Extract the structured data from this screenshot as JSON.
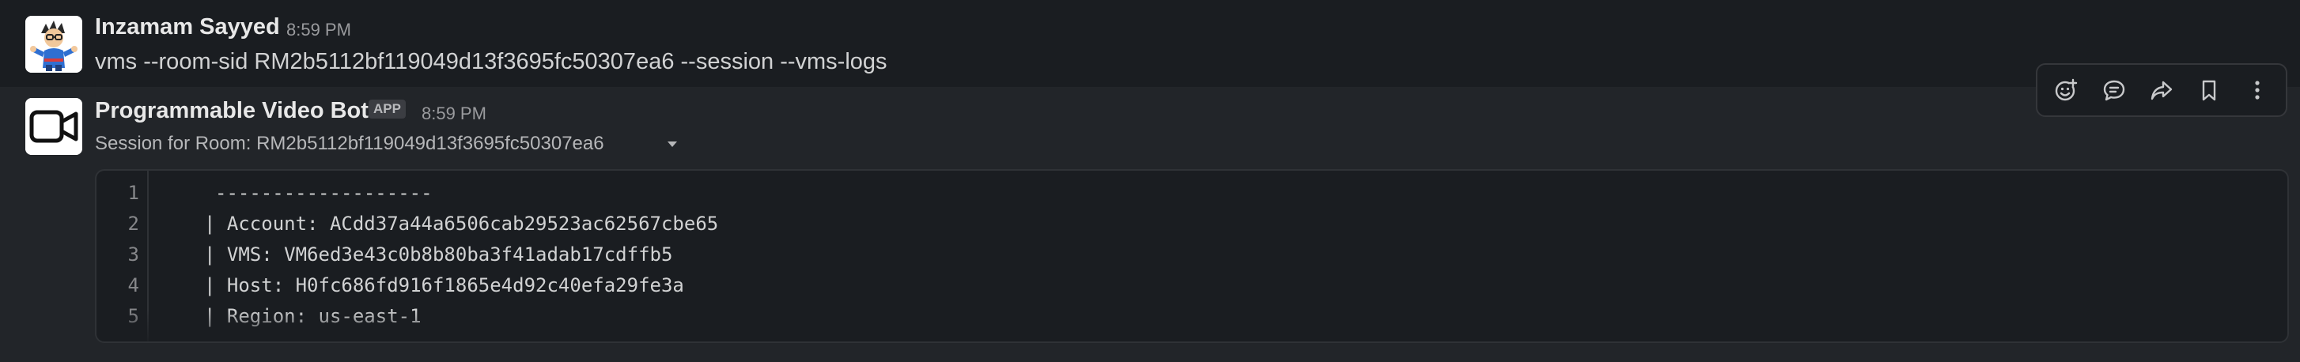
{
  "messages": [
    {
      "author": "Inzamam Sayyed",
      "time": "8:59 PM",
      "text": "vms --room-sid RM2b5112bf119049d13f3695fc50307ea6 --session --vms-logs"
    },
    {
      "author": "Programmable Video Bot",
      "badge": "APP",
      "time": "8:59 PM",
      "subtitle": "Session for Room: RM2b5112bf119049d13f3695fc50307ea6",
      "code_lines": [
        {
          "num": "1",
          "text": "-------------------"
        },
        {
          "num": "2",
          "text": "| Account: ACdd37a44a6506cab29523ac62567cbe65"
        },
        {
          "num": "3",
          "text": "| VMS: VM6ed3e43c0b8b80ba3f41adab17cdffb5"
        },
        {
          "num": "4",
          "text": "| Host: H0fc686fd916f1865e4d92c40efa29fe3a"
        },
        {
          "num": "5",
          "text": "| Region: us-east-1"
        }
      ]
    }
  ],
  "toolbar": {
    "icons": [
      "add-reaction-icon",
      "reply-in-thread-icon",
      "forward-icon",
      "bookmark-icon",
      "more-actions-icon"
    ]
  },
  "colors": {
    "background": "#1a1d21",
    "hover_background": "#222529",
    "text": "#d1d2d3",
    "muted": "#9a9b9e"
  }
}
